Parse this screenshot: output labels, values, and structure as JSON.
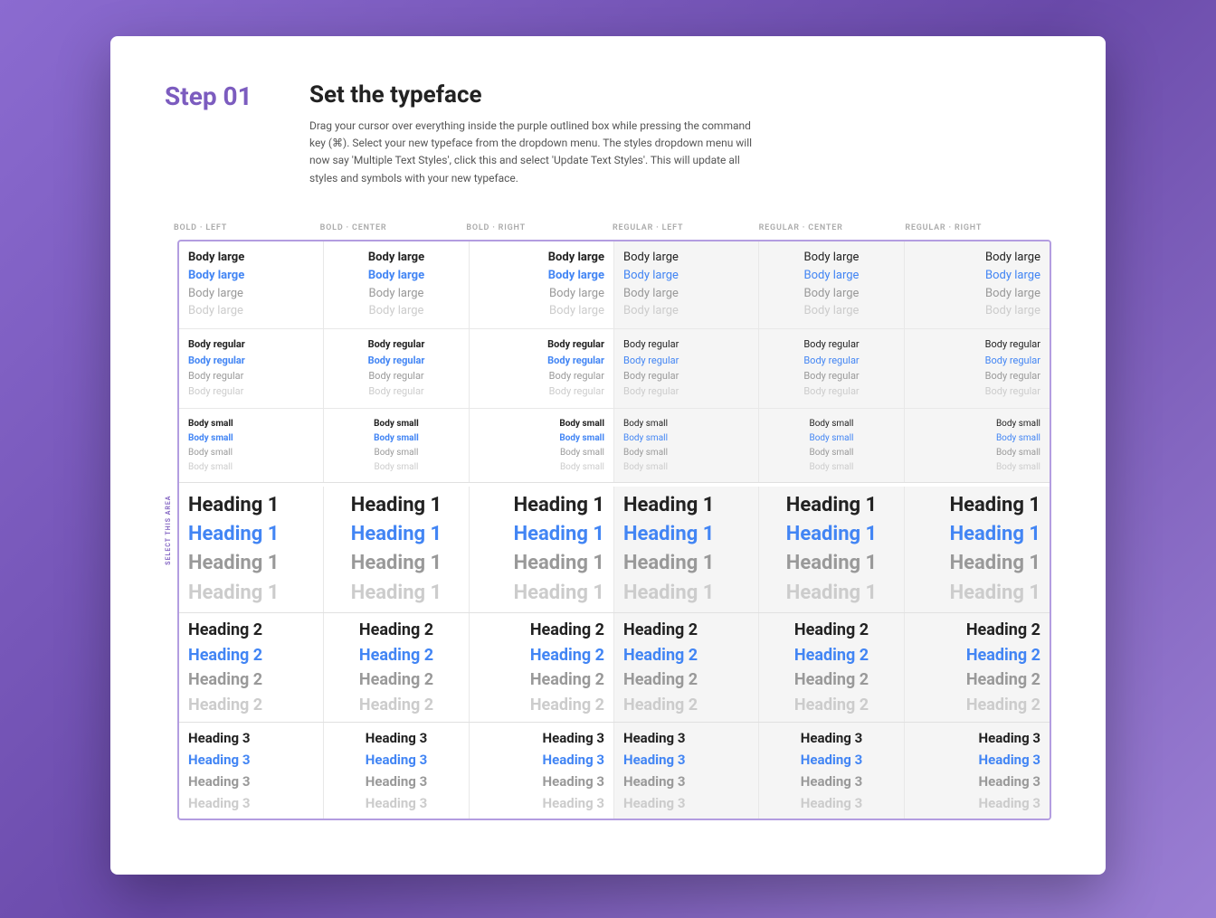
{
  "page": {
    "step": "Step 01",
    "title": "Set the typeface",
    "description": "Drag your cursor over everything inside the purple outlined box while pressing the command key (⌘). Select your new typeface from the dropdown menu. The styles dropdown menu will now say 'Multiple Text Styles', click this and select 'Update Text Styles'. This will update all styles and symbols with your new typeface.",
    "select_label": "SELECT THIS AREA"
  },
  "columns": [
    {
      "label": "BOLD · LEFT",
      "bg": false
    },
    {
      "label": "BOLD · CENTER",
      "bg": false
    },
    {
      "label": "BOLD · RIGHT",
      "bg": false
    },
    {
      "label": "REGULAR · LEFT",
      "bg": true
    },
    {
      "label": "REGULAR · CENTER",
      "bg": true
    },
    {
      "label": "REGULAR · RIGHT",
      "bg": true
    }
  ],
  "body_sections": [
    {
      "size": "Body large",
      "rows": [
        {
          "text": "Body large",
          "color": "black",
          "weight": "bold"
        },
        {
          "text": "Body large",
          "color": "blue",
          "weight": "bold"
        },
        {
          "text": "Body large",
          "color": "gray",
          "weight": "regular"
        },
        {
          "text": "Body large",
          "color": "light-gray",
          "weight": "regular"
        }
      ]
    },
    {
      "size": "Body regular",
      "rows": [
        {
          "text": "Body regular",
          "color": "black",
          "weight": "bold"
        },
        {
          "text": "Body regular",
          "color": "blue",
          "weight": "bold"
        },
        {
          "text": "Body regular",
          "color": "gray",
          "weight": "regular"
        },
        {
          "text": "Body regular",
          "color": "light-gray",
          "weight": "regular"
        }
      ]
    },
    {
      "size": "Body small",
      "rows": [
        {
          "text": "Body small",
          "color": "black",
          "weight": "bold"
        },
        {
          "text": "Body small",
          "color": "blue",
          "weight": "bold"
        },
        {
          "text": "Body small",
          "color": "gray",
          "weight": "regular"
        },
        {
          "text": "Body small",
          "color": "light-gray",
          "weight": "regular"
        }
      ]
    }
  ],
  "heading_sections": [
    {
      "label": "Heading 1",
      "size_class": "h1-text",
      "rows": [
        {
          "text": "Heading 1",
          "color": "black",
          "weight": "bold"
        },
        {
          "text": "Heading 1",
          "color": "blue",
          "weight": "bold"
        },
        {
          "text": "Heading 1",
          "color": "gray",
          "weight": "regular"
        },
        {
          "text": "Heading 1",
          "color": "light-gray",
          "weight": "regular"
        }
      ]
    },
    {
      "label": "Heading 2",
      "size_class": "h2-text",
      "rows": [
        {
          "text": "Heading 2",
          "color": "black",
          "weight": "bold"
        },
        {
          "text": "Heading 2",
          "color": "blue",
          "weight": "bold"
        },
        {
          "text": "Heading 2",
          "color": "gray",
          "weight": "regular"
        },
        {
          "text": "Heading 2",
          "color": "light-gray",
          "weight": "regular"
        }
      ]
    },
    {
      "label": "Heading 3",
      "size_class": "h3-text",
      "rows": [
        {
          "text": "Heading 3",
          "color": "black",
          "weight": "bold"
        },
        {
          "text": "Heading 3",
          "color": "blue",
          "weight": "bold"
        },
        {
          "text": "Heading 3",
          "color": "gray",
          "weight": "regular"
        },
        {
          "text": "Heading 3",
          "color": "light-gray",
          "weight": "regular"
        }
      ]
    }
  ]
}
